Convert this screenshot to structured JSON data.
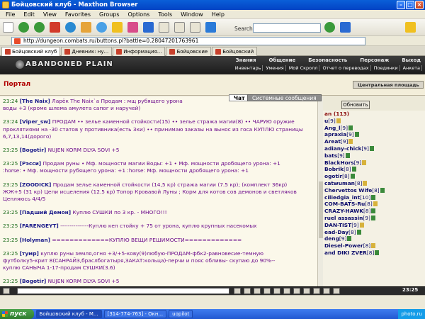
{
  "window": {
    "title": "Бойцовский клуб - Maxthon Browser"
  },
  "menu": [
    "File",
    "Edit",
    "View",
    "Favorites",
    "Groups",
    "Options",
    "Tools",
    "Window",
    "Help"
  ],
  "toolbar": {
    "search_label": "Search"
  },
  "address": {
    "url": "http://dungeon.combats.ru/buttons.pl?battle=0.28047201763961"
  },
  "tabs": [
    "Бойцовский клуб",
    "Дневник: ну...",
    "Информация...",
    "Бойцовские",
    "Бойцовский"
  ],
  "game": {
    "logo": "ABANDONED PLAIN",
    "nav_top": [
      "Знания",
      "Общение",
      "Безопасность",
      "Персонаж",
      "Выход"
    ],
    "nav_bottom": [
      "Инвентарь",
      "Умения",
      "Мой Скролл",
      "Отчет о переводах",
      "Поединки",
      "Анкета"
    ]
  },
  "portal": {
    "title": "Портал",
    "location": "Центральная площадь",
    "chat_tab": "Чат",
    "sys_tab": "Системные сообщения",
    "refresh": "Обновить"
  },
  "chat": [
    {
      "time": "23:24",
      "nick": "[The Naix]",
      "text": "Ларёк The Naix`a  Продам : мщ рубящего урона"
    },
    {
      "time": "",
      "nick": "",
      "text": "воды +3 (кроме шлема амулета сапог и наручей)"
    },
    {
      "time": "23:24",
      "nick": "[Viper_sw]",
      "text": "ПРОДАМ •• зелье каменной стойкости(15) •• зелье стража магии(8) •• ЧАРУЮ оружие"
    },
    {
      "time": "",
      "nick": "",
      "text": "проклятиями на -30 статов у противника(есть 3ки) •• принимаю заказы на вынос из госа КУПЛЮ страницы"
    },
    {
      "time": "",
      "nick": "",
      "text": "6,7,13,14(дорого)"
    },
    {
      "time": "23:25",
      "nick": "[Bogotir]",
      "text": "NUJEN KORM DLYA SOVI +5"
    },
    {
      "time": "23:25",
      "nick": "[Рэсси]",
      "text": "Продам руны  • Мф. мощности магии Воды: +1  • Мф. мощности дробящего урона: +1"
    },
    {
      "time": "",
      "nick": "",
      "text": ":horse: • Мф. мощности рубящего урона: +1 :horse: Мф. мощности дробящего урона: +1"
    },
    {
      "time": "23:25",
      "nick": "[ZOODICK]",
      "text": "Продам зелье каменной стойкости (14,5 кр) стража магии (7.5 кр); (комплект 36кр)"
    },
    {
      "time": "",
      "nick": "",
      "text": "ЖЖ+5 (31 кр) Цепи исцеления (12.5 кр) Топор Кровавой Луны ; Корм для котов сов демонов и светляков"
    },
    {
      "time": "",
      "nick": "",
      "text": "Цепляюсь 4/4/5"
    },
    {
      "time": "23:25",
      "nick": "[Падший Демон]",
      "text": "Куплю СУШКИ по 3 кр. - МНОГО!!!"
    },
    {
      "time": "23:25",
      "nick": "[FARENGEYT]",
      "text": "---------------Куплю кеп стойку + 75 от урона, куплю крупных насекомых"
    },
    {
      "time": "23:25",
      "nick": "[Holyman]",
      "text": "=============КУПЛЮ ВЕЩИ РЕШИМОСТИ============="
    },
    {
      "time": "23:25",
      "nick": "[тумр]",
      "text": "куплю руны земля,огня +3/+5-кову(9)любую-ПРОДАМ-фбк2-равновесие-темную"
    },
    {
      "time": "",
      "nick": "",
      "text": "футболку5-крит 8(САНРАЙЗ,браслбогатыря,ЗАКАТ:кольца)-перчи и пояс обливы-   скупаю до 90%--"
    },
    {
      "time": "",
      "nick": "",
      "text": "куплю САНЫЧА 1-17-продам СУШКИ(3.6)"
    },
    {
      "time": "23:25",
      "nick": "[Bogotir]",
      "text": "NUJEN KORM DLYA SOVI +5"
    }
  ],
  "userlist": {
    "header": "an (113)",
    "users": [
      {
        "name": "u",
        "level": "[9]"
      },
      {
        "name": "Ang_l",
        "level": "[9]"
      },
      {
        "name": "apraxia",
        "level": "[9]"
      },
      {
        "name": "Areat",
        "level": "[9]"
      },
      {
        "name": "adiany-chick",
        "level": "[9]"
      },
      {
        "name": "bats",
        "level": "[9]"
      },
      {
        "name": "BlackHors",
        "level": "[9]"
      },
      {
        "name": "Bobrik",
        "level": "[8]"
      },
      {
        "name": "ogotir",
        "level": "[8]"
      },
      {
        "name": "catwuman",
        "level": "[8]"
      },
      {
        "name": "Chervettos Wife",
        "level": "[8]"
      },
      {
        "name": "ciliedgia_int",
        "level": "[10]"
      },
      {
        "name": "COM-BATS-Ru",
        "level": "[8]"
      },
      {
        "name": "CRAZY-HAWK",
        "level": "[8]"
      },
      {
        "name": "ruel assassin",
        "level": "[9]"
      },
      {
        "name": "DAN-TIST",
        "level": "[9]"
      },
      {
        "name": "ead-Day",
        "level": "[8]"
      },
      {
        "name": "deng",
        "level": "[9]"
      },
      {
        "name": "Diesel-Power",
        "level": "[8]"
      },
      {
        "name": "and DIKI ZVER",
        "level": "[8]"
      }
    ]
  },
  "clock": "23:25",
  "taskbar": {
    "start": "пуск",
    "tasks": [
      "Бойцовский клуб - M...",
      "[314-774-763] - Окн...",
      "uopilot"
    ],
    "tray": "photo.ru"
  }
}
